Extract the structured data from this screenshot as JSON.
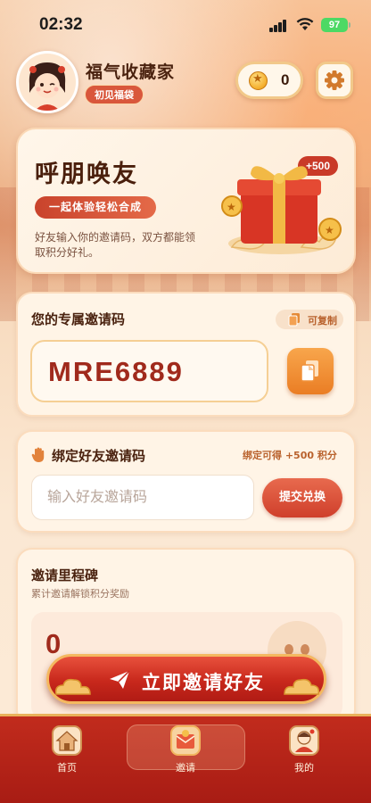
{
  "status_bar": {
    "time": "02:32",
    "battery": "97"
  },
  "profile": {
    "name": "福气收藏家",
    "badge": "初见福袋"
  },
  "wallet": {
    "coins": "0"
  },
  "hero": {
    "title": "呼朋唤友",
    "pill": "一起体验轻松合成",
    "description": "好友输入你的邀请码，双方都能领取积分好礼。",
    "reward_badge": "+500"
  },
  "invite_code_card": {
    "title": "您的专属邀请码",
    "copy_hint": "可复制",
    "code": "MRE6889"
  },
  "bind_card": {
    "title": "绑定好友邀请码",
    "reward_note": "绑定可得 +500 积分",
    "input_placeholder": "输入好友邀请码",
    "submit_label": "提交兑换"
  },
  "milestone_card": {
    "title": "邀请里程碑",
    "subtitle": "累计邀请解锁积分奖励",
    "count": "0"
  },
  "cta": {
    "label": "立即邀请好友"
  },
  "tabbar": {
    "tabs": [
      {
        "label": "首页",
        "icon": "home-icon",
        "active": false
      },
      {
        "label": "邀请",
        "icon": "invite-icon",
        "active": true
      },
      {
        "label": "我的",
        "icon": "profile-icon",
        "active": false
      }
    ]
  },
  "colors": {
    "primary_red": "#c8281c",
    "accent_orange": "#ea7d24",
    "gold": "#f4b860",
    "background": "#fbe7cf"
  }
}
